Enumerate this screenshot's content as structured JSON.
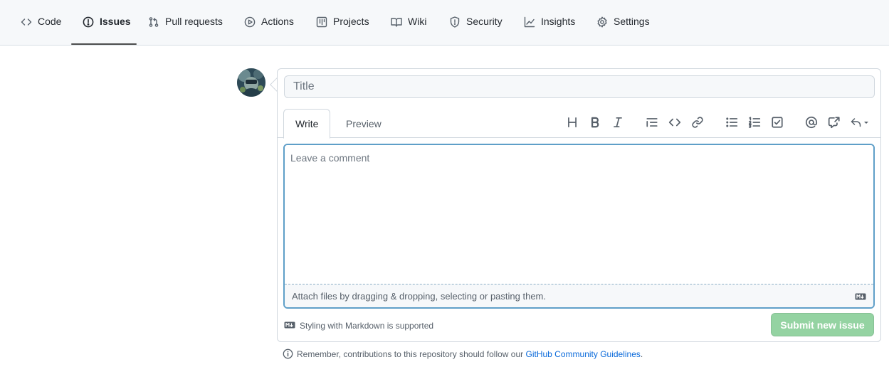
{
  "nav": {
    "items": [
      {
        "label": "Code",
        "icon": "code-icon"
      },
      {
        "label": "Issues",
        "icon": "issue-opened-icon",
        "selected": true
      },
      {
        "label": "Pull requests",
        "icon": "git-pull-request-icon"
      },
      {
        "label": "Actions",
        "icon": "play-icon"
      },
      {
        "label": "Projects",
        "icon": "table-icon"
      },
      {
        "label": "Wiki",
        "icon": "book-icon"
      },
      {
        "label": "Security",
        "icon": "shield-icon"
      },
      {
        "label": "Insights",
        "icon": "graph-icon"
      },
      {
        "label": "Settings",
        "icon": "gear-icon"
      }
    ]
  },
  "composer": {
    "title_placeholder": "Title",
    "tabs": [
      "Write",
      "Preview"
    ],
    "active_tab": "Write",
    "toolbar": [
      "heading-icon",
      "bold-icon",
      "italic-icon",
      "quote-icon",
      "code-icon",
      "link-icon",
      "unordered-list-icon",
      "ordered-list-icon",
      "task-list-icon",
      "mention-icon",
      "cross-reference-icon",
      "reply-icon"
    ],
    "comment_placeholder": "Leave a comment",
    "attach_text": "Attach files by dragging & dropping, selecting or pasting them.",
    "markdown_note": "Styling with Markdown is supported",
    "submit_label": "Submit new issue"
  },
  "footer": {
    "guidelines_prefix": "Remember, contributions to this repository should follow our",
    "guidelines_link": "GitHub Community Guidelines",
    "guidelines_suffix": "."
  },
  "colors": {
    "submit_disabled": "#94d3a2",
    "focus_border": "#5f9fc8",
    "link": "#0969da"
  }
}
